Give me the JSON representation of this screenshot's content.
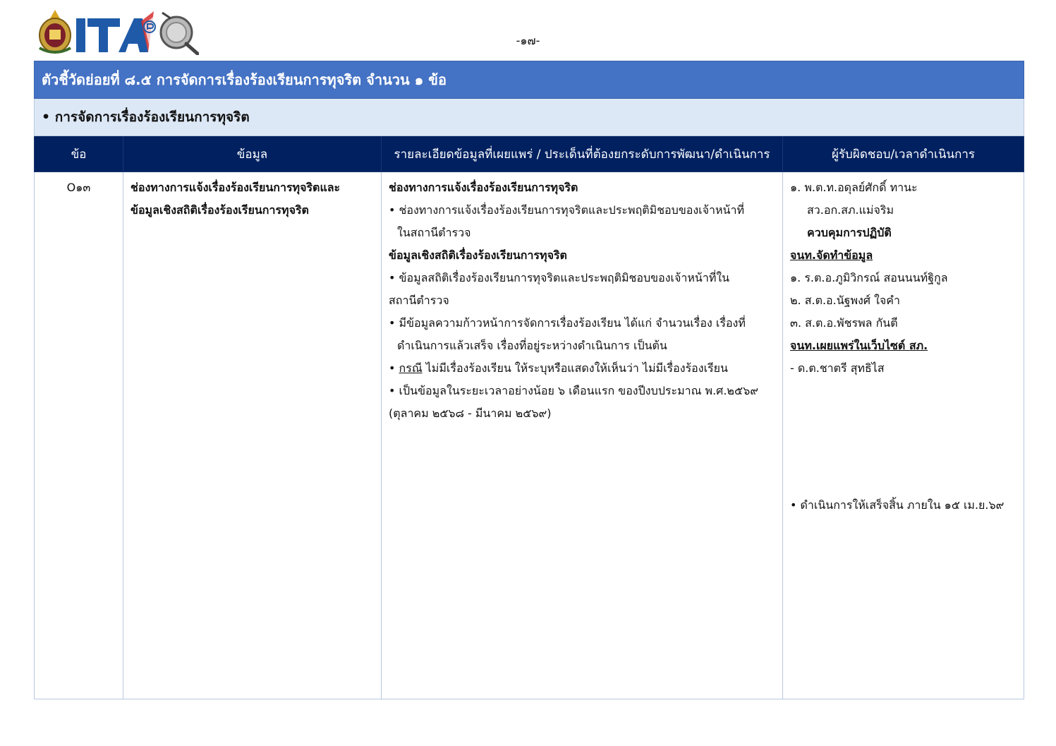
{
  "header": {
    "logo_name": "ITA",
    "page_number": "-๑๗-"
  },
  "table": {
    "title": "ตัวชี้วัดย่อยที่ ๘.๕ การจัดการเรื่องร้องเรียนการทุจริต จำนวน ๑ ข้อ",
    "subtitle": "• การจัดการเรื่องร้องเรียนการทุจริต",
    "columns": [
      "ข้อ",
      "ข้อมูล",
      "รายละเอียดข้อมูลที่เผยแพร่ / ประเด็นที่ต้องยกระดับการพัฒนา/ดำเนินการ",
      "ผู้รับผิดชอบ/เวลาดำเนินการ"
    ],
    "row": {
      "no": "O๑๓",
      "info": [
        "ช่องทางการแจ้งเรื่องร้องเรียนการทุจริตและ",
        "ข้อมูลเชิงสถิติเรื่องร้องเรียนการทุจริต"
      ],
      "detail": {
        "h1": "ช่องทางการแจ้งเรื่องร้องเรียนการทุจริต",
        "b1_l1": "• ช่องทางการแจ้งเรื่องร้องเรียนการทุจริตและประพฤติมิชอบของเจ้าหน้าที่",
        "b1_l2": "ในสถานีตำรวจ",
        "h2": "ข้อมูลเชิงสถิติเรื่องร้องเรียนการทุจริต",
        "b2_l1": "• ข้อมูลสถิติเรื่องร้องเรียนการทุจริตและประพฤติมิชอบของเจ้าหน้าที่ใน",
        "b2_l2": "สถานีตำรวจ",
        "b3_l1": "• มีข้อมูลความก้าวหน้าการจัดการเรื่องร้องเรียน ได้แก่ จำนวนเรื่อง เรื่องที่",
        "b3_l2": "ดำเนินการแล้วเสร็จ เรื่องที่อยู่ระหว่างดำเนินการ เป็นต้น",
        "b4_bullet": "• ",
        "b4_case": "กรณี",
        "b4_rest": "  ไม่มีเรื่องร้องเรียน ให้ระบุหรือแสดงให้เห็นว่า ไม่มีเรื่องร้องเรียน",
        "b5_l1": "• เป็นข้อมูลในระยะเวลาอย่างน้อย ๖ เดือนแรก ของปีงบประมาณ พ.ศ.๒๕๖๙",
        "b5_l2": "(ตุลาคม ๒๕๖๘ - มีนาคม ๒๕๖๙)"
      },
      "responsible": {
        "p1": "๑. พ.ต.ท.อดุลย์ศักดิ์  ทานะ",
        "p1_pos": "สว.อก.สภ.แม่จริม",
        "p1_role": "ควบคุมการปฏิบัติ",
        "h_data": "จนท.จัดทำข้อมูล",
        "d1": "๑. ร.ต.อ.ภูมิวิกรณ์  สอนนนท์ฐิกูล",
        "d2": "๒. ส.ต.อ.นัฐพงศ์  ใจคำ",
        "d3": "๓. ส.ต.อ.พัชรพล  กันตี",
        "h_web": "จนท.เผยแพร่ในเว็บไซต์ สภ.",
        "w1": "- ด.ต.ชาตรี  สุทธิไส",
        "deadline": "• ดำเนินการให้เสร็จสิ้น ภายใน ๑๕ เม.ย.๖๙"
      }
    }
  },
  "colors": {
    "title_bg": "#4472c4",
    "subtitle_bg": "#dde8f6",
    "header_bg": "#002060",
    "border": "#b9c8e0"
  }
}
